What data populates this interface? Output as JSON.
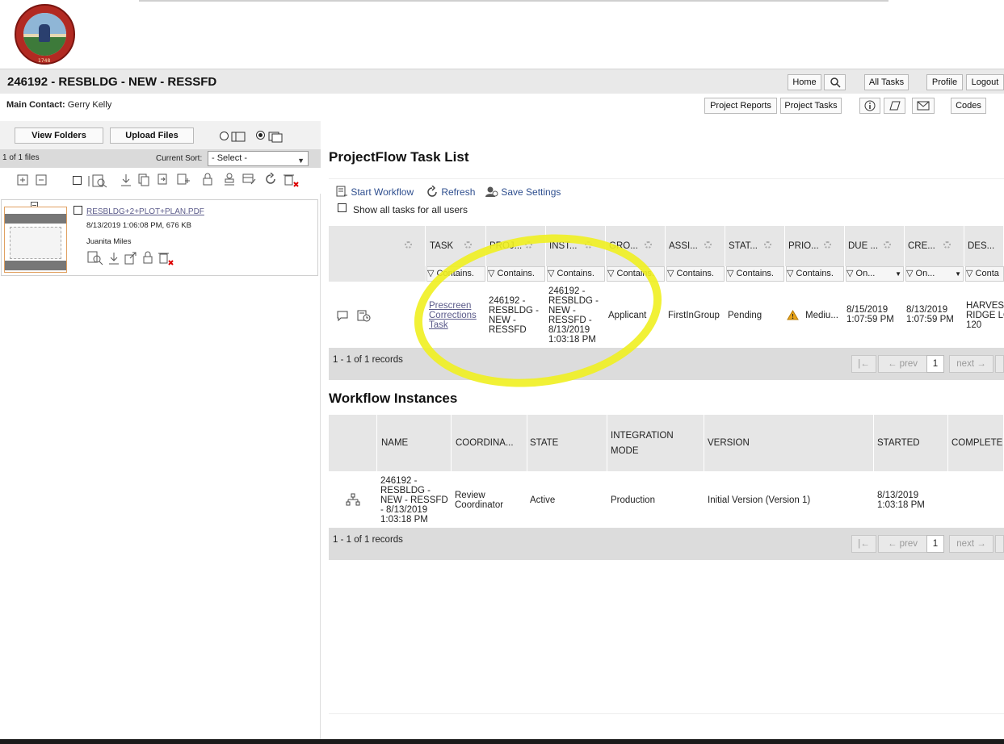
{
  "header": {
    "seal_text": "1748",
    "project_title": "246192 - RESBLDG - NEW - RESSFD",
    "main_contact_label": "Main Contact:",
    "main_contact_value": "Gerry Kelly",
    "nav": {
      "home": "Home",
      "all_tasks": "All Tasks",
      "profile": "Profile",
      "logout": "Logout",
      "project_reports": "Project Reports",
      "project_tasks": "Project Tasks",
      "codes": "Codes"
    }
  },
  "left": {
    "view_folders": "View Folders",
    "upload_files": "Upload Files",
    "file_count": "1 of 1 files",
    "current_sort_label": "Current Sort:",
    "sort_value": "- Select -",
    "file": {
      "name": "RESBLDG+2+PLOT+PLAN.PDF",
      "meta": "8/13/2019 1:06:08 PM, 676 KB",
      "owner": "Juanita Miles"
    }
  },
  "tasks": {
    "title": "ProjectFlow Task List",
    "start_workflow": "Start Workflow",
    "refresh": "Refresh",
    "save_settings": "Save Settings",
    "show_all": "Show all tasks for all users",
    "columns": [
      "TASK",
      "PROJ...",
      "INST...",
      "GRO...",
      "ASSI...",
      "STAT...",
      "PRIO...",
      "DUE ...",
      "CRE...",
      "DES..."
    ],
    "filters": [
      "Contains.",
      "Contains.",
      "Contains.",
      "Contains.",
      "Contains.",
      "Contains.",
      "Contains.",
      "On...",
      "On...",
      "Conta"
    ],
    "row": {
      "task": [
        "Prescreen",
        "Corrections",
        "Task"
      ],
      "project": [
        "246192 -",
        "RESBLDG -",
        "NEW -",
        "RESSFD"
      ],
      "instance": [
        "246192 -",
        "RESBLDG -",
        "NEW -",
        "RESSFD -",
        "8/13/2019",
        "1:03:18 PM"
      ],
      "group": "Applicant",
      "assignee": "FirstInGroup",
      "status": "Pending",
      "priority": "Mediu...",
      "due": [
        "8/15/2019",
        "1:07:59 PM"
      ],
      "created": [
        "8/13/2019",
        "1:07:59 PM"
      ],
      "description": [
        "HARVEST",
        "RIDGE LO",
        "120"
      ]
    },
    "records": "1 - 1 of 1 records",
    "pager": {
      "prev": "← prev",
      "page": "1",
      "next": "next →"
    }
  },
  "workflow": {
    "title": "Workflow Instances",
    "columns": [
      "NAME",
      "COORDINA...",
      "STATE",
      "INTEGRATION",
      "MODE",
      "VERSION",
      "STARTED",
      "COMPLETED"
    ],
    "row": {
      "name": [
        "246192 -",
        "RESBLDG -",
        "NEW - RESSFD",
        "- 8/13/2019",
        "1:03:18 PM"
      ],
      "coordinator": [
        "Review",
        "Coordinator"
      ],
      "state": "Active",
      "integration": "Production",
      "version": "Initial Version (Version 1)",
      "started": [
        "8/13/2019",
        "1:03:18 PM"
      ]
    },
    "records": "1 - 1 of 1 records",
    "pager": {
      "prev": "← prev",
      "page": "1",
      "next": "next →"
    }
  }
}
